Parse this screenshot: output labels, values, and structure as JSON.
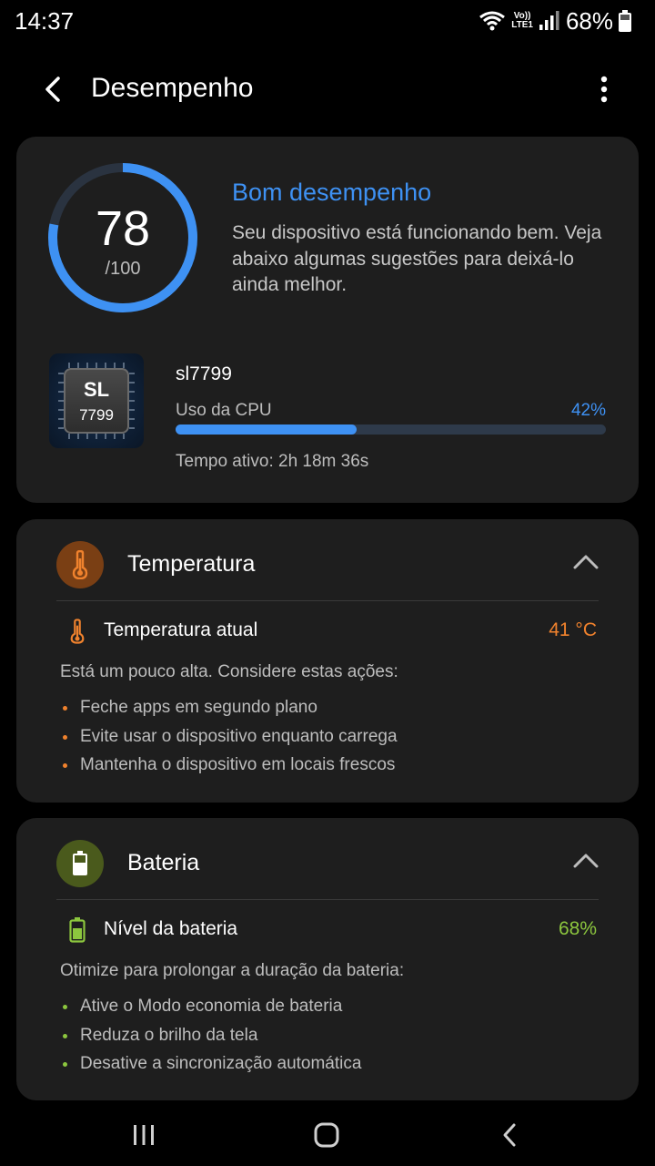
{
  "status_bar": {
    "time": "14:37",
    "battery_pct": "68%",
    "network_line1": "Vo))",
    "network_line2": "LTE1"
  },
  "header": {
    "title": "Desempenho"
  },
  "performance": {
    "score": "78",
    "score_max": "/100",
    "score_fraction": 0.78,
    "status_title": "Bom desempenho",
    "status_desc": "Seu dispositivo está funcionando bem. Veja abaixo algumas sugestões para deixá-lo ainda melhor.",
    "chip_line1": "SL",
    "chip_line2": "7799",
    "chip_name": "sl7799",
    "cpu_label": "Uso da CPU",
    "cpu_value": "42%",
    "cpu_fraction": 0.42,
    "uptime": "Tempo ativo: 2h 18m 36s"
  },
  "temperature": {
    "title": "Temperatura",
    "row_label": "Temperatura atual",
    "row_value": "41 °C",
    "hint": "Está um pouco alta. Considere estas ações:",
    "tips": [
      "Feche apps em segundo plano",
      "Evite usar o dispositivo enquanto carrega",
      "Mantenha o dispositivo em locais frescos"
    ],
    "accent": "#f0822d"
  },
  "battery": {
    "title": "Bateria",
    "row_label": "Nível da bateria",
    "row_value": "68%",
    "hint": "Otimize para prolongar a duração da bateria:",
    "tips": [
      "Ative o Modo economia de bateria",
      "Reduza o brilho da tela",
      "Desative a sincronização automática"
    ],
    "accent": "#8cc63e"
  },
  "colors": {
    "accent_blue": "#3e91f3",
    "card_bg": "#1e1e1e"
  },
  "icons": {
    "back": "back-arrow-icon",
    "more": "more-vertical-icon",
    "temperature": "thermometer-icon",
    "battery": "battery-icon",
    "collapse": "chevron-up-icon",
    "nav_recents": "recents-icon",
    "nav_home": "home-icon",
    "nav_back": "nav-back-icon"
  }
}
